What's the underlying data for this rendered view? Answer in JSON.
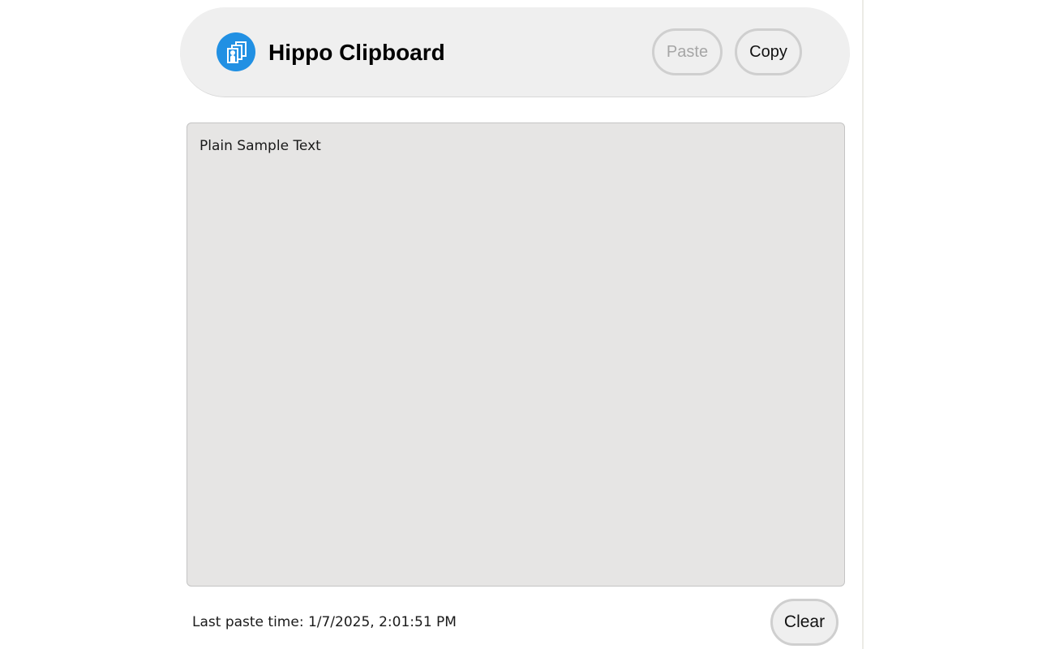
{
  "app": {
    "title": "Hippo Clipboard",
    "icon": "clipboard-copy-icon",
    "accent_color": "#2190e3"
  },
  "toolbar": {
    "paste_label": "Paste",
    "paste_enabled": false,
    "copy_label": "Copy"
  },
  "editor": {
    "text": "Plain Sample Text"
  },
  "footer": {
    "last_paste_label": "Last paste time: 1/7/2025, 2:01:51 PM",
    "clear_label": "Clear"
  }
}
